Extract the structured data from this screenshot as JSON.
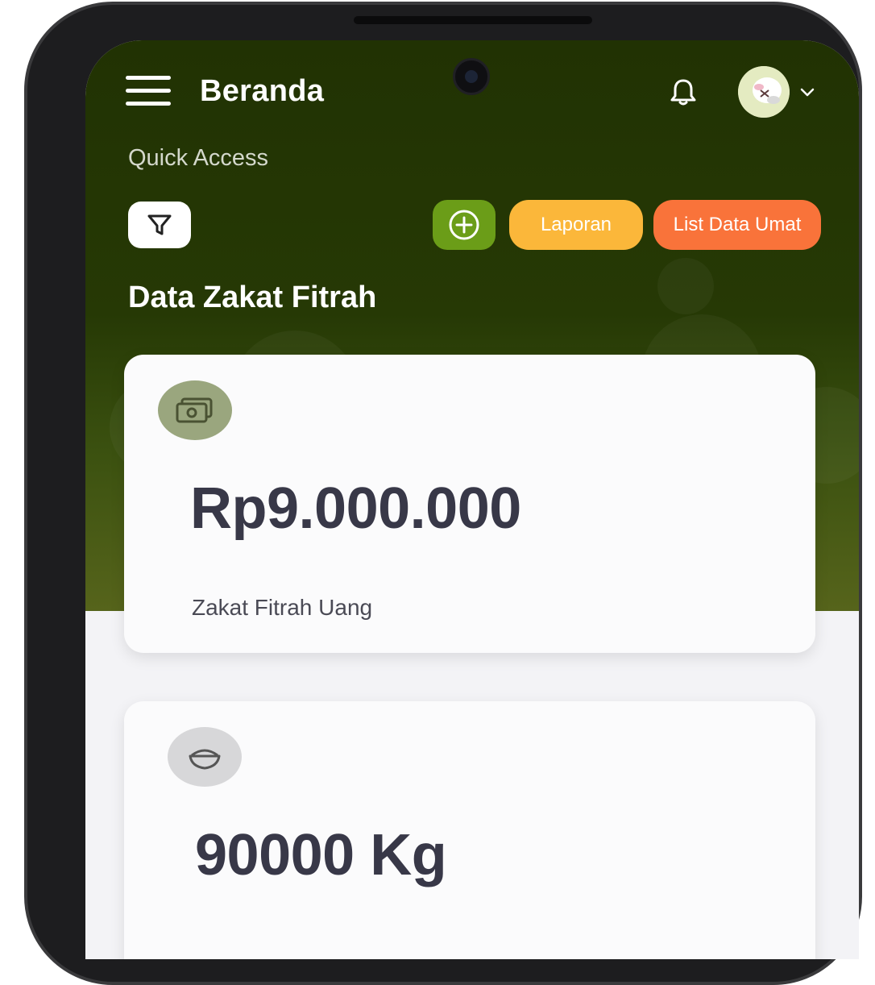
{
  "header": {
    "title": "Beranda",
    "icons": {
      "menu": "hamburger-menu-icon",
      "notification": "bell-icon",
      "avatar": "user-avatar",
      "dropdown": "chevron-down-icon"
    }
  },
  "quick_access": {
    "label": "Quick Access",
    "filter_icon": "filter-icon",
    "add_icon": "plus-circle-icon",
    "buttons": {
      "laporan": "Laporan",
      "list_data_umat": "List Data Umat"
    }
  },
  "section": {
    "title": "Data Zakat Fitrah"
  },
  "cards": [
    {
      "icon": "money-icon",
      "value": "Rp9.000.000",
      "label": "Zakat Fitrah Uang",
      "icon_bg": "#9aa67e"
    },
    {
      "icon": "rice-bowl-icon",
      "value": "90000 Kg",
      "icon_bg": "#d7d7d9"
    }
  ],
  "colors": {
    "header_bg": "#213203",
    "add_button": "#6b9d18",
    "laporan_button": "#fbb73a",
    "list_button": "#f9733a",
    "value_text": "#383848"
  }
}
